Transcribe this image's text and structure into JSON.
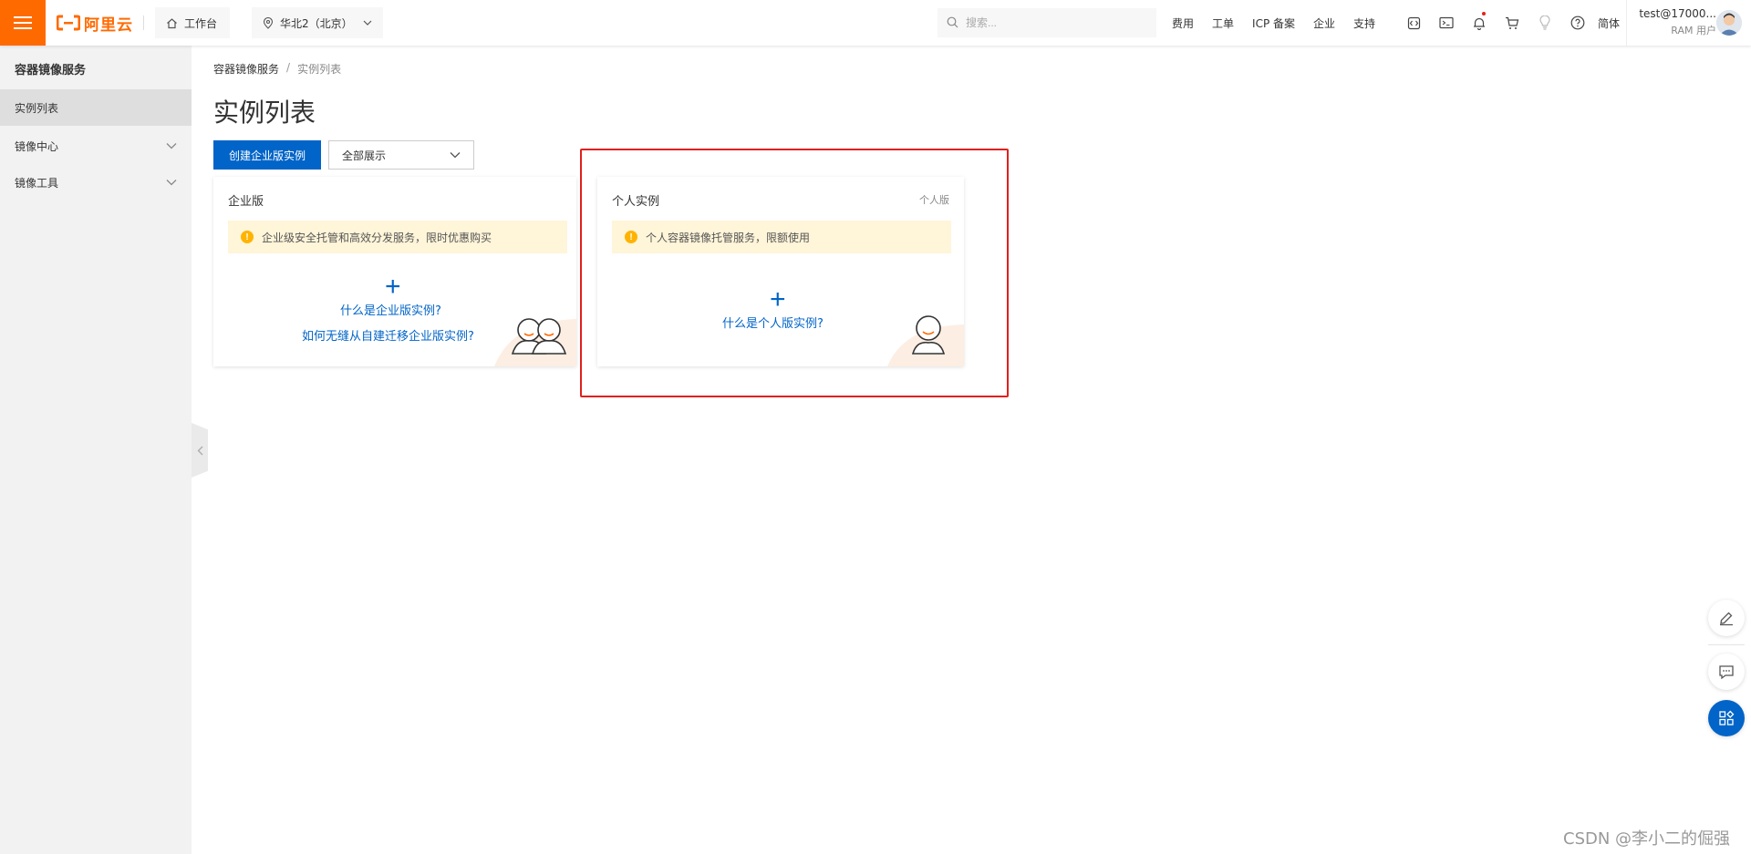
{
  "topbar": {
    "logo_text": "阿里云",
    "workbench_label": "工作台",
    "region_label": "华北2（北京）",
    "search_placeholder": "搜索...",
    "nav_links": [
      "费用",
      "工单",
      "ICP 备案",
      "企业",
      "支持"
    ],
    "lang_label": "简体",
    "user_name": "test@17000...",
    "user_role": "RAM 用户",
    "accent_color": "#ff6a00"
  },
  "sidebar": {
    "title": "容器镜像服务",
    "items": [
      {
        "label": "实例列表",
        "active": true
      },
      {
        "label": "镜像中心",
        "expandable": true
      },
      {
        "label": "镜像工具",
        "expandable": true
      }
    ]
  },
  "main": {
    "breadcrumb": {
      "root": "容器镜像服务",
      "separator": "/",
      "current": "实例列表"
    },
    "title": "实例列表",
    "create_button": "创建企业版实例",
    "filter_select": "全部展示",
    "primary_color": "#0064c8"
  },
  "cards": {
    "enterprise": {
      "title": "企业版",
      "notice": "企业级安全托管和高效分发服务，限时优惠购买",
      "plus": "+",
      "link1": "什么是企业版实例?",
      "link2": "如何无缝从自建迁移企业版实例?"
    },
    "personal": {
      "title": "个人实例",
      "tag": "个人版",
      "notice": "个人容器镜像托管服务，限额使用",
      "plus": "+",
      "link1": "什么是个人版实例?"
    }
  },
  "highlight_color": "#e0201d",
  "watermark": "CSDN @李小二的倔强"
}
